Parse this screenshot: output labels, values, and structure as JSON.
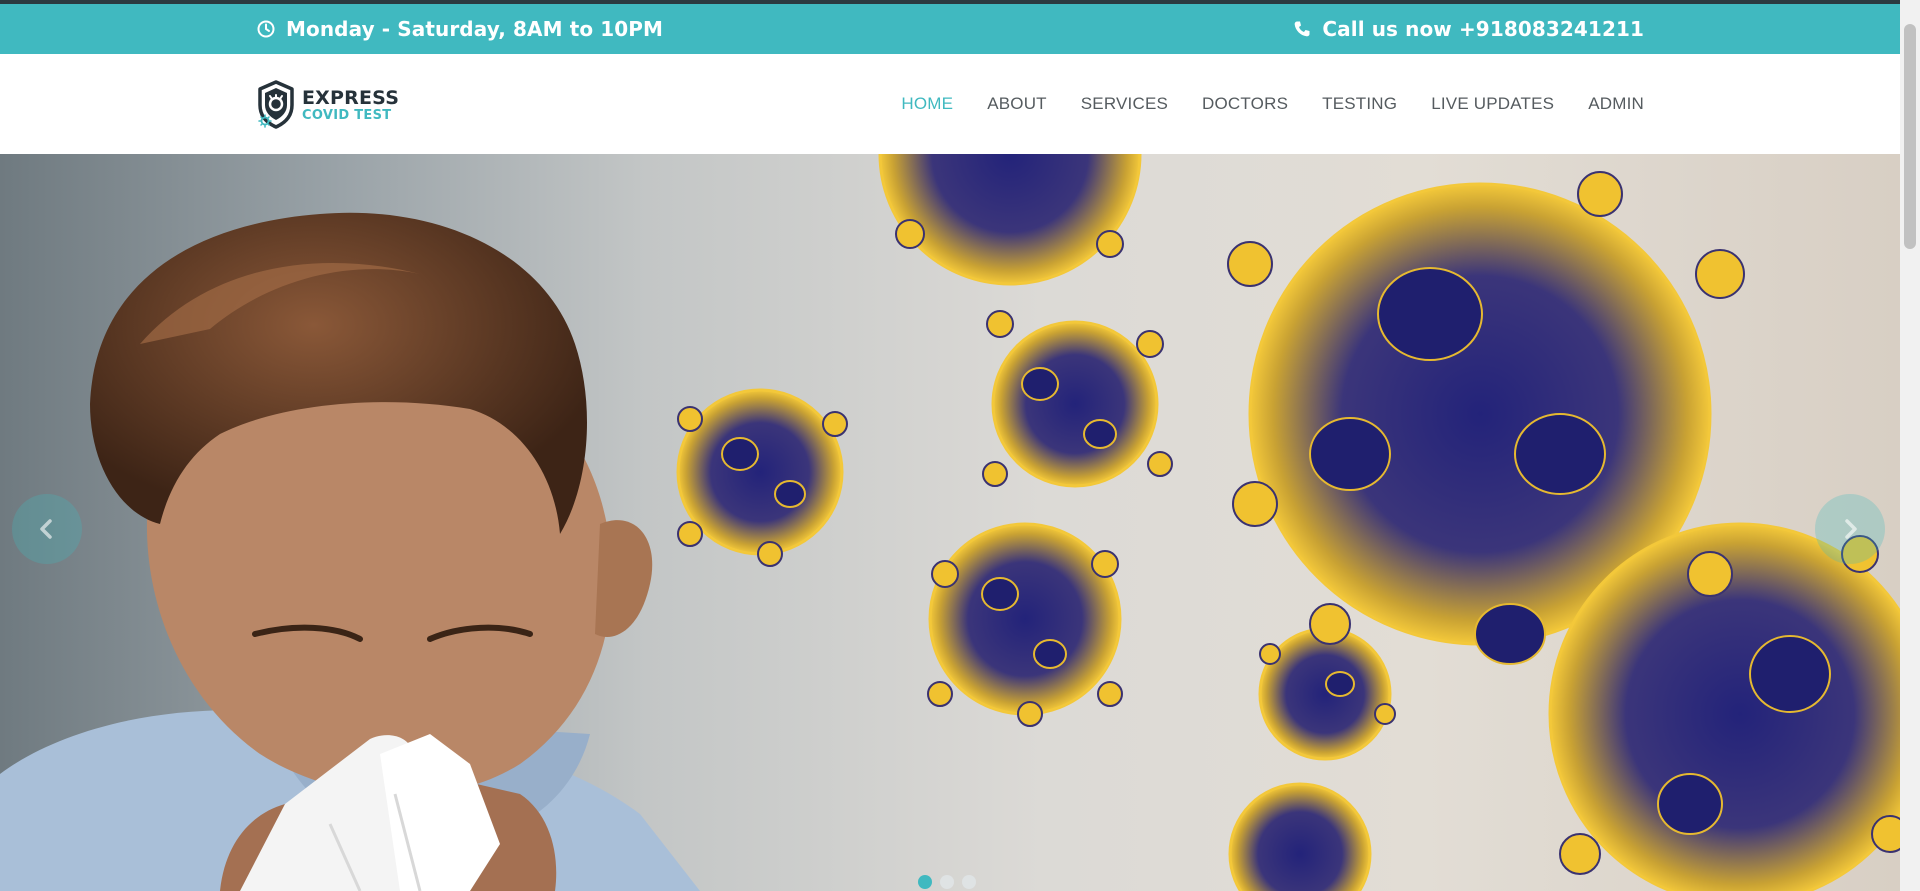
{
  "topbar": {
    "hours_icon": "clock-icon",
    "hours_text": "Monday - Saturday, 8AM to 10PM",
    "phone_icon": "phone-icon",
    "phone_text": "Call us now +918083241211",
    "background_color": "#40b9c0"
  },
  "logo": {
    "icon": "shield-virus-icon",
    "line1": "EXPRESS",
    "line2": "COVID TEST"
  },
  "nav": {
    "items": [
      {
        "label": "HOME",
        "active": true
      },
      {
        "label": "ABOUT",
        "active": false
      },
      {
        "label": "SERVICES",
        "active": false
      },
      {
        "label": "DOCTORS",
        "active": false
      },
      {
        "label": "TESTING",
        "active": false
      },
      {
        "label": "LIVE UPDATES",
        "active": false
      },
      {
        "label": "ADMIN",
        "active": false
      }
    ],
    "active_color": "#40b9c0",
    "text_color": "#555b5f"
  },
  "hero": {
    "image": "man sneezing into tissue beside coronavirus particles",
    "prev_icon": "chevron-left-icon",
    "next_icon": "chevron-right-icon",
    "slides": 3,
    "active_slide": 1,
    "virus_color": "#f0c230",
    "virus_core_color": "#2a2a78"
  }
}
